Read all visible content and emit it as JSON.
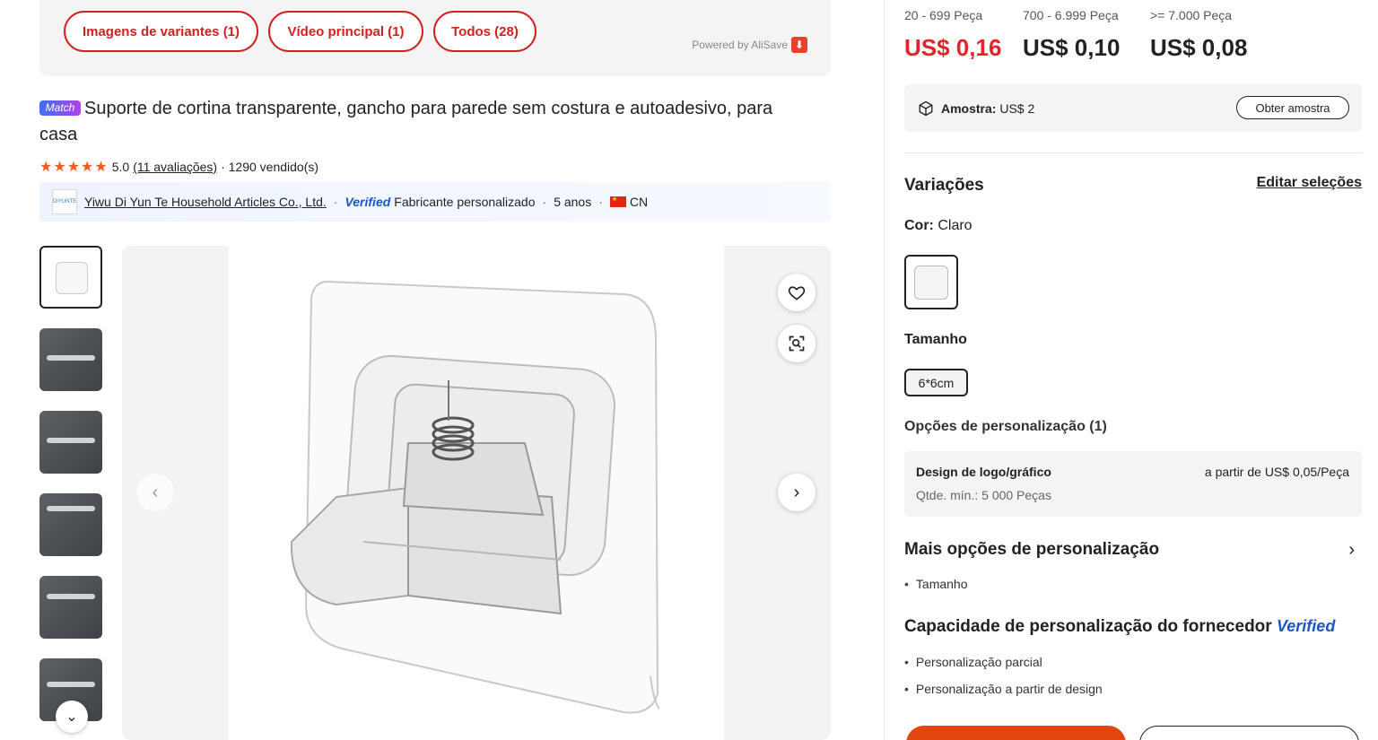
{
  "tabs": [
    {
      "label": "Imagens de variantes (1)"
    },
    {
      "label": "Vídeo principal (1)"
    },
    {
      "label": "Todos (28)"
    }
  ],
  "powered_by": "Powered by AliSave",
  "product": {
    "badge": "Match",
    "title": "Suporte de cortina transparente, gancho para parede sem costura e autoadesivo, para casa",
    "rating": "5.0",
    "reviews": "(11 avaliações)",
    "sold": "· 1290 vendido(s)"
  },
  "supplier": {
    "logo_text": "DIYUNTE",
    "name": "Yiwu Di Yun Te Household Articles Co., Ltd.",
    "verified": "Verified",
    "type": "Fabricante personalizado",
    "years": "5 anos",
    "country": "CN"
  },
  "thumbnails": [
    {
      "name": "thumb-1",
      "active": true
    },
    {
      "name": "thumb-2"
    },
    {
      "name": "thumb-3"
    },
    {
      "name": "thumb-4"
    },
    {
      "name": "thumb-5"
    },
    {
      "name": "thumb-6"
    }
  ],
  "pricing": {
    "tiers": [
      {
        "range": "20 - 699 Peça",
        "price": "US$ 0,16"
      },
      {
        "range": "700 - 6.999 Peça",
        "price": "US$ 0,10"
      },
      {
        "range": ">= 7.000 Peça",
        "price": "US$ 0,08"
      }
    ]
  },
  "sample": {
    "label": "Amostra:",
    "price": "US$ 2",
    "button": "Obter amostra"
  },
  "variations": {
    "heading": "Variações",
    "edit": "Editar seleções",
    "color_label": "Cor:",
    "color_value": "Claro",
    "size_label": "Tamanho",
    "size_value": "6*6cm"
  },
  "customization": {
    "heading": "Opções de personalização (1)",
    "item_title": "Design de logo/gráfico",
    "item_price": "a partir de US$ 0,05/Peça",
    "item_min": "Qtde. mín.: 5 000 Peças",
    "more_heading": "Mais opções de personalização",
    "more_items": [
      "Tamanho"
    ],
    "capacity_heading": "Capacidade de personalização do fornecedor",
    "capacity_verified": "Verified",
    "capacity_items": [
      "Personalização parcial",
      "Personalização a partir de design"
    ]
  },
  "colors": {
    "accent": "#d21f1f",
    "price_red": "#e2252b",
    "verified_blue": "#1a56c6",
    "cta_orange": "#e2450d"
  }
}
